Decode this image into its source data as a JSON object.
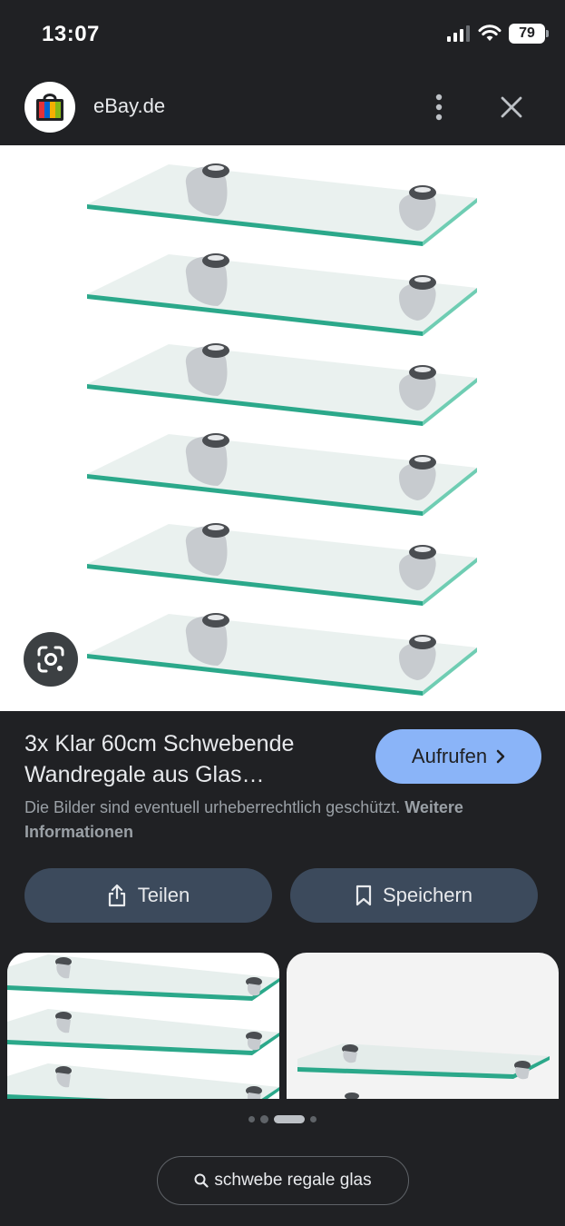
{
  "status_bar": {
    "time": "13:07",
    "battery": "79",
    "icons": [
      "signal-icon",
      "wifi-icon",
      "battery-icon"
    ]
  },
  "header": {
    "site_name": "eBay.de",
    "logo_icon": "ebay-shopping-bag-icon",
    "more_icon": "more-vertical-icon",
    "close_icon": "close-icon"
  },
  "image": {
    "lens_icon": "google-lens-icon"
  },
  "result": {
    "title": "3x Klar 60cm Schwebende Wandregale aus Glas…",
    "visit_label": "Aufrufen",
    "copyright_text": "Die Bilder sind eventuell urheberrechtlich geschützt.",
    "copyright_link": "Weitere Informationen"
  },
  "actions": {
    "share_label": "Teilen",
    "save_label": "Speichern"
  },
  "related": {
    "selected_page": 3,
    "total_pages": 4
  },
  "search": {
    "query": "schwebe regale glas"
  },
  "colors": {
    "background": "#202124",
    "accent": "#8ab4f8",
    "button": "#3c4a5c",
    "glass_edge": "#2ba88a"
  }
}
